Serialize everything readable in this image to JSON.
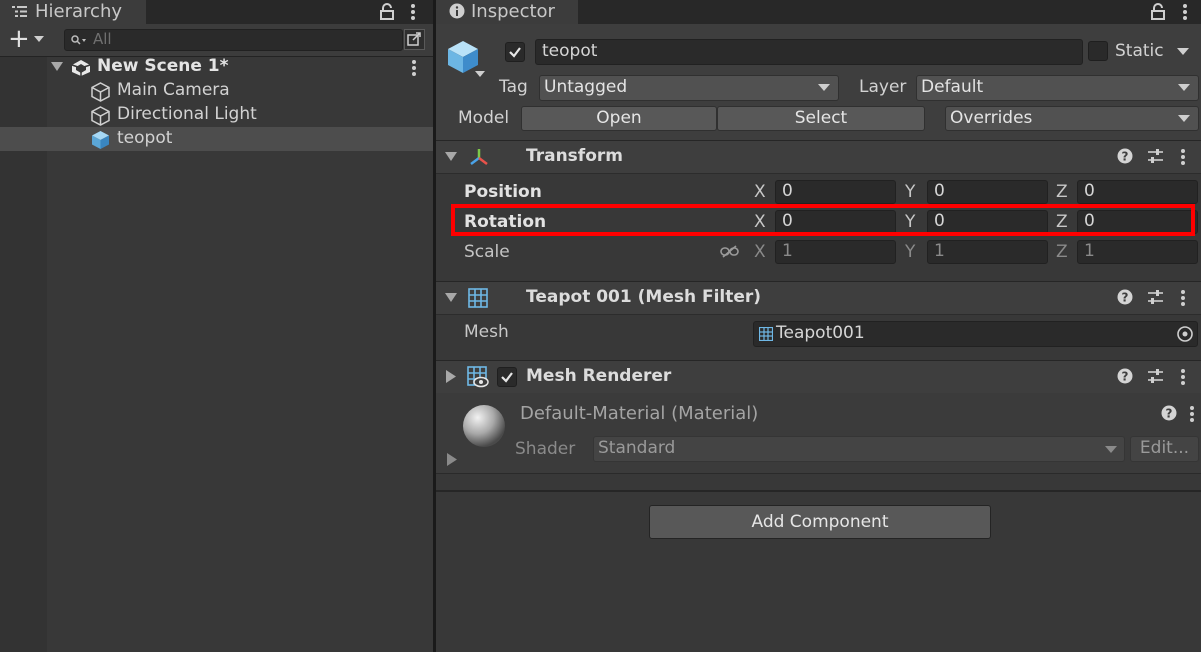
{
  "hierarchy": {
    "tab_label": "Hierarchy",
    "add_label": "+",
    "search_placeholder": "All",
    "scene": "New Scene 1*",
    "items": [
      {
        "label": "Main Camera"
      },
      {
        "label": "Directional Light"
      },
      {
        "label": "teopot",
        "selected": true
      }
    ]
  },
  "inspector": {
    "tab_label": "Inspector",
    "object_name": "teopot",
    "active": true,
    "static_label": "Static",
    "tag_label": "Tag",
    "tag_value": "Untagged",
    "layer_label": "Layer",
    "layer_value": "Default",
    "model_label": "Model",
    "open_label": "Open",
    "select_label": "Select",
    "overrides_label": "Overrides",
    "transform": {
      "title": "Transform",
      "position": {
        "label": "Position",
        "x": "0",
        "y": "0",
        "z": "0"
      },
      "rotation": {
        "label": "Rotation",
        "x": "0",
        "y": "0",
        "z": "0"
      },
      "scale": {
        "label": "Scale",
        "x": "1",
        "y": "1",
        "z": "1"
      },
      "axis_x": "X",
      "axis_y": "Y",
      "axis_z": "Z"
    },
    "mesh_filter": {
      "title": "Teapot 001 (Mesh Filter)",
      "mesh_label": "Mesh",
      "mesh_value": "Teapot001"
    },
    "mesh_renderer": {
      "title": "Mesh Renderer",
      "enabled": true
    },
    "material": {
      "name": "Default-Material (Material)",
      "shader_label": "Shader",
      "shader_value": "Standard",
      "edit_label": "Edit..."
    },
    "add_component_label": "Add Component"
  },
  "colors": {
    "highlight": "#ff0000",
    "selection": "#4d4d4d",
    "accent_blue": "#6fb8e6"
  }
}
